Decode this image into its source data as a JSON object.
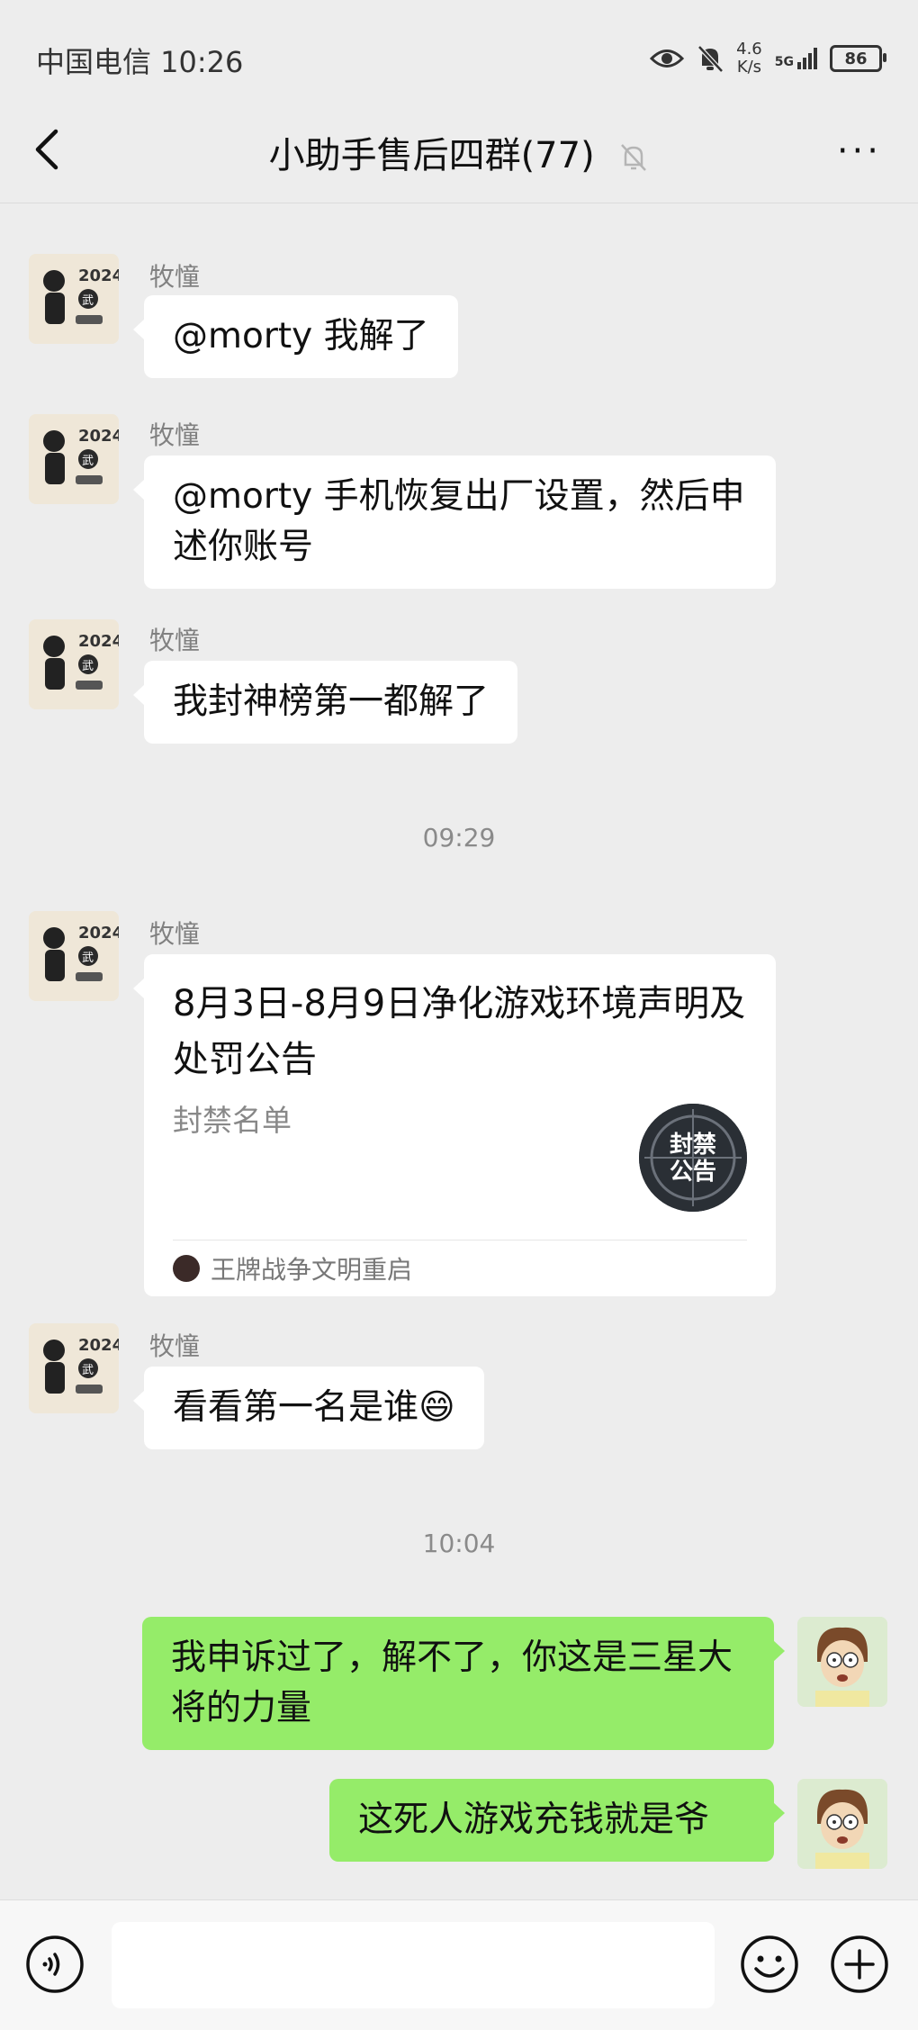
{
  "status_bar": {
    "carrier_time": "中国电信 10:26",
    "net_speed_value": "4.6",
    "net_speed_unit": "K/s",
    "signal_label": "5G",
    "battery": "86"
  },
  "nav": {
    "back_icon": "chevron-left-icon",
    "title": "小助手售后四群(77)",
    "muted_icon": "bell-off-icon",
    "more_label": "···"
  },
  "messages": [
    {
      "sender": "牧憧",
      "text": "@morty  我解了"
    },
    {
      "sender": "牧憧",
      "text": "@morty  手机恢复出厂设置，然后申述你账号"
    },
    {
      "sender": "牧憧",
      "text": "我封神榜第一都解了"
    },
    {
      "time": "09:29"
    },
    {
      "sender": "牧憧",
      "card": {
        "title": "8月3日-8月9日净化游戏环境声明及处罚公告",
        "desc": "封禁名单",
        "thumb_text": "封禁公告",
        "source": "王牌战争文明重启"
      }
    },
    {
      "sender": "牧憧",
      "text": "看看第一名是谁😄"
    },
    {
      "time": "10:04"
    },
    {
      "self": true,
      "text": "我申诉过了，解不了，你这是三星大将的力量"
    },
    {
      "self": true,
      "text": "这死人游戏充钱就是爷"
    }
  ],
  "avatar_left_text": "2024",
  "avatar_left_badge": "武",
  "input": {
    "voice_icon": "voice-icon",
    "emoji_icon": "emoji-icon",
    "plus_icon": "plus-icon",
    "value": ""
  },
  "colors": {
    "self_bubble": "#95ec69",
    "other_bubble": "#ffffff",
    "background": "#ededed"
  }
}
